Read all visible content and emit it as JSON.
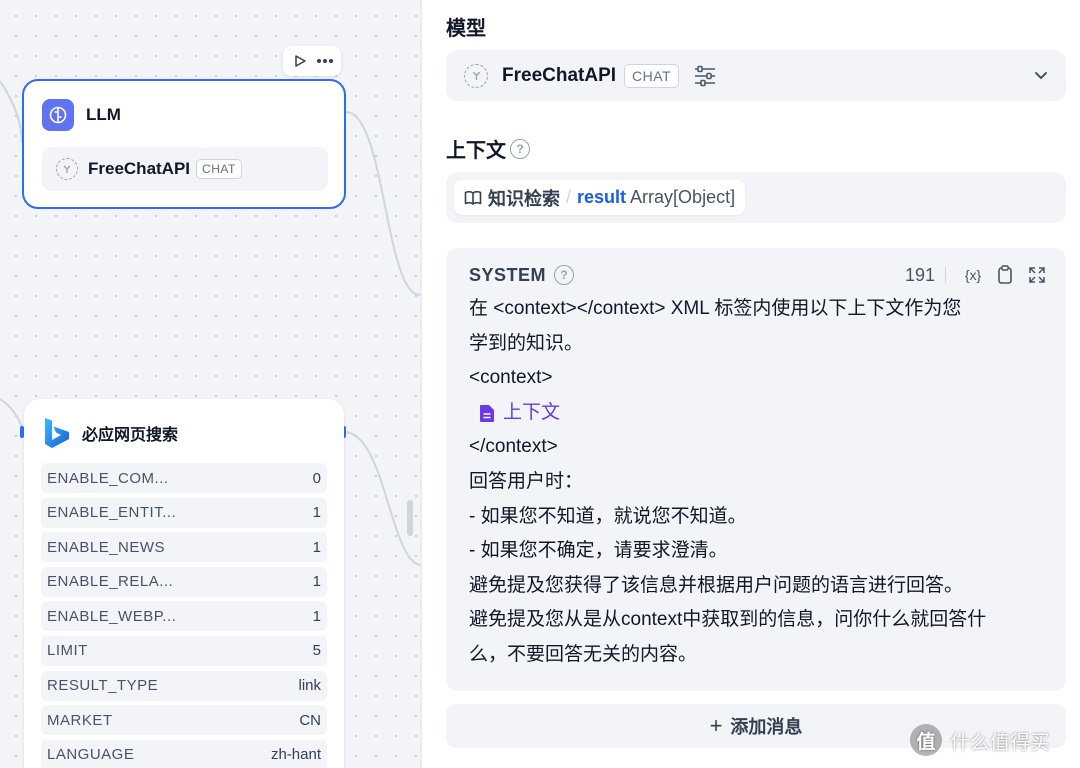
{
  "llm_node": {
    "title": "LLM",
    "model_name": "FreeChatAPI",
    "model_tag": "CHAT"
  },
  "bing_node": {
    "title": "必应网页搜索",
    "params": [
      {
        "key": "ENABLE_COM...",
        "value": "0"
      },
      {
        "key": "ENABLE_ENTIT...",
        "value": "1"
      },
      {
        "key": "ENABLE_NEWS",
        "value": "1"
      },
      {
        "key": "ENABLE_RELA...",
        "value": "1"
      },
      {
        "key": "ENABLE_WEBP...",
        "value": "1"
      },
      {
        "key": "LIMIT",
        "value": "5"
      },
      {
        "key": "RESULT_TYPE",
        "value": "link"
      },
      {
        "key": "MARKET",
        "value": "CN"
      },
      {
        "key": "LANGUAGE",
        "value": "zh-hant"
      }
    ]
  },
  "panel": {
    "model_label": "模型",
    "model_name": "FreeChatAPI",
    "model_tag": "CHAT",
    "context_label": "上下文",
    "context_var": {
      "node": "知识检索",
      "separator": "/",
      "name": "result",
      "type": "Array[Object]"
    },
    "system": {
      "title": "SYSTEM",
      "count": "191",
      "var_icon_text": "{x}",
      "lines": [
        "在 <context></context> XML 标签内使用以下上下文作为您",
        "学到的知识。",
        "<context>",
        "</context>",
        "回答用户时：",
        "- 如果您不知道，就说您不知道。",
        "- 如果您不确定，请要求澄清。",
        "避免提及您获得了该信息并根据用户问题的语言进行回答。",
        "避免提及您从是从context中获取到的信息，问你什么就回答什",
        "么，不要回答无关的内容。"
      ],
      "context_var_label": "上下文"
    },
    "add_message": {
      "plus": "+",
      "label": "添加消息"
    }
  },
  "watermark": {
    "logo": "值",
    "text": "什么值得买"
  },
  "colors": {
    "accent": "#2e6cf6",
    "llm_icon_bg": "#6172f3",
    "variable_blue": "#155eef",
    "context_purple": "#6938ef",
    "field_bg": "#f2f4f7"
  }
}
